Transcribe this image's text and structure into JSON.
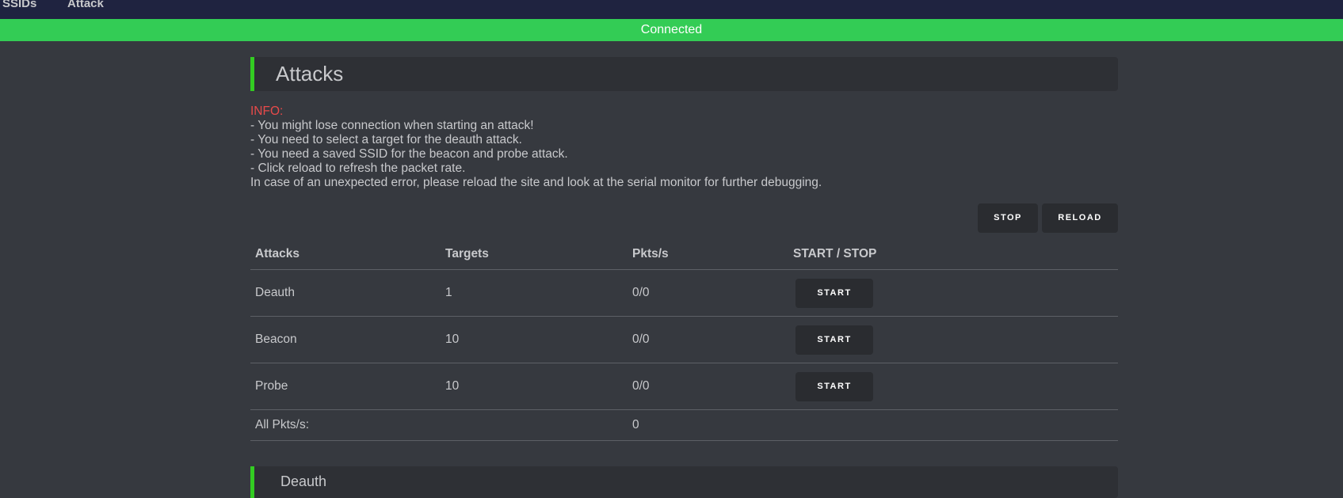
{
  "nav": {
    "items": [
      {
        "label": "SSIDs"
      },
      {
        "label": "Attack"
      }
    ]
  },
  "status": {
    "text": "Connected",
    "color": "#33cc55"
  },
  "page": {
    "title": "Attacks",
    "accent_color": "#33cc22"
  },
  "info": {
    "title": "INFO:",
    "lines": [
      "- You might lose connection when starting an attack!",
      "- You need to select a target for the deauth attack.",
      "- You need a saved SSID for the beacon and probe attack.",
      "- Click reload to refresh the packet rate.",
      "In case of an unexpected error, please reload the site and look at the serial monitor for further debugging."
    ]
  },
  "toolbar": {
    "stop_label": "STOP",
    "reload_label": "RELOAD"
  },
  "table": {
    "headers": [
      "Attacks",
      "Targets",
      "Pkts/s",
      "START / STOP"
    ],
    "rows": [
      {
        "attack": "Deauth",
        "targets": "1",
        "pkts": "0/0",
        "action": "START"
      },
      {
        "attack": "Beacon",
        "targets": "10",
        "pkts": "0/0",
        "action": "START"
      },
      {
        "attack": "Probe",
        "targets": "10",
        "pkts": "0/0",
        "action": "START"
      }
    ],
    "total_label": "All Pkts/s:",
    "total_value": "0"
  },
  "next_section": {
    "title": "Deauth"
  }
}
